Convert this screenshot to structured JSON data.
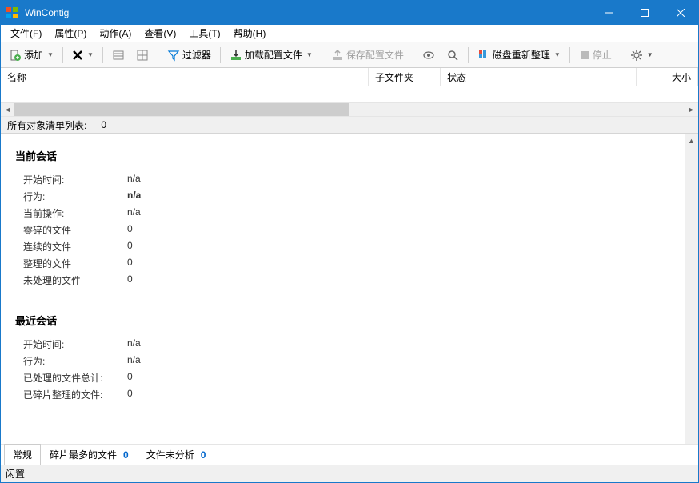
{
  "window": {
    "title": "WinContig"
  },
  "menu": {
    "file": "文件(F)",
    "attr": "属性(P)",
    "action": "动作(A)",
    "view": "查看(V)",
    "tools": "工具(T)",
    "help": "帮助(H)"
  },
  "toolbar": {
    "add": "添加",
    "filter": "过滤器",
    "load_config": "加载配置文件",
    "save_config": "保存配置文件",
    "defrag": "磁盘重新整理",
    "stop": "停止"
  },
  "columns": {
    "name": "名称",
    "subfolder": "子文件夹",
    "status": "状态",
    "size": "大小"
  },
  "list_status": {
    "label": "所有对象清单列表:",
    "count": "0"
  },
  "session": {
    "current_title": "当前会话",
    "recent_title": "最近会话",
    "start_time_label": "开始时间:",
    "behavior_label": "行为:",
    "current_op_label": "当前操作:",
    "fragmented_label": "零碎的文件",
    "contiguous_label": "连续的文件",
    "defragged_label": "整理的文件",
    "unprocessed_label": "未处理的文件",
    "processed_total_label": "已处理的文件总计:",
    "defragged_files_label": "已碎片整理的文件:",
    "na": "n/a",
    "zero": "0"
  },
  "tabs": {
    "general": "常规",
    "most_fragmented": "碎片最多的文件",
    "most_fragmented_count": "0",
    "not_analyzed": "文件未分析",
    "not_analyzed_count": "0"
  },
  "statusbar": {
    "text": "闲置"
  }
}
